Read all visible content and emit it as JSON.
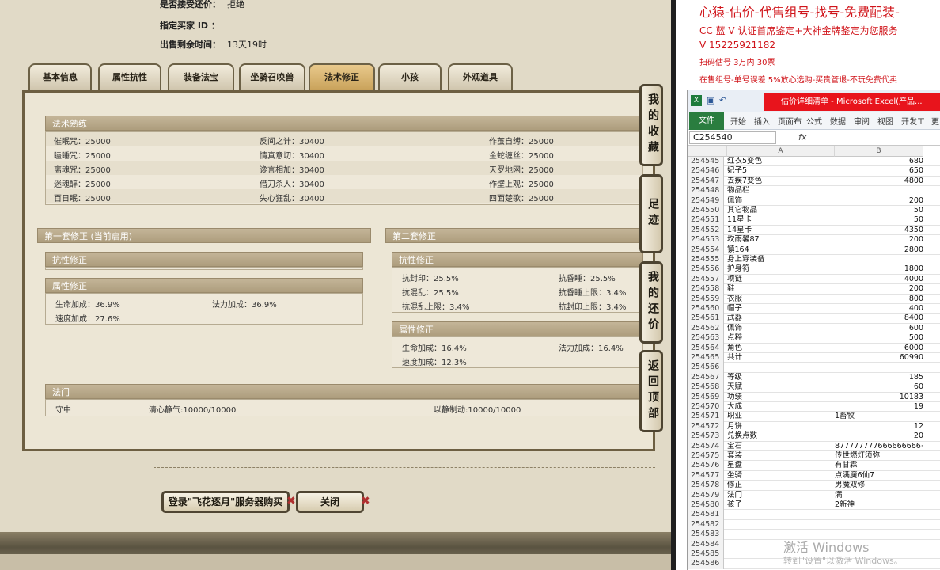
{
  "info": {
    "bargain_label": "是否接受还价：",
    "bargain_value": "拒绝",
    "buyer_label": "指定买家 ID ：",
    "remain_label": "出售剩余时间：",
    "remain_value": "13天19时"
  },
  "tabs": [
    "基本信息",
    "属性抗性",
    "装备法宝",
    "坐骑召唤兽",
    "法术修正",
    "小孩",
    "外观道具"
  ],
  "spell_mastery": {
    "title": "法术熟练",
    "col1": [
      "催眠咒：25000",
      "瞌睡咒：25000",
      "离魂咒：25000",
      "迷魂醉：25000",
      "百日眠：25000"
    ],
    "col2": [
      "反间之计：30400",
      "情真意切：30400",
      "谗言相加：30400",
      "借刀杀人：30400",
      "失心狂乱：30400"
    ],
    "col3": [
      "作茧自缚：25000",
      "金蛇缠丝：25000",
      "天罗地网：25000",
      "作壁上观：25000",
      "四面楚歌：25000"
    ]
  },
  "set1": {
    "title": "第一套修正 (当前启用)",
    "resist_title": "抗性修正",
    "attr_title": "属性修正",
    "attr": [
      "生命加成：36.9%",
      "法力加成：36.9%",
      "速度加成：27.6%"
    ]
  },
  "set2": {
    "title": "第二套修正",
    "resist_title": "抗性修正",
    "resist": [
      "抗封印：25.5%",
      "抗昏睡：25.5%",
      "抗混乱：25.5%",
      "抗昏睡上限：3.4%",
      "抗混乱上限：3.4%",
      "抗封印上限：3.4%"
    ],
    "attr_title": "属性修正",
    "attr": [
      "生命加成：16.4%",
      "法力加成：16.4%",
      "速度加成：12.3%"
    ]
  },
  "fameng": {
    "title": "法门",
    "items": [
      "守中",
      "清心静气:10000/10000",
      "以静制动:10000/10000"
    ]
  },
  "side_buttons": [
    "我的收藏",
    "足迹",
    "我的还价",
    "返回顶部"
  ],
  "buttons": {
    "login": "登录\"飞花逐月\"服务器购买",
    "close": "关闭"
  },
  "ad": {
    "title": "心猿-估价-代售组号-找号-免费配装-",
    "lines": [
      "CC 蓝 V 认证首席鉴定+大神金牌鉴定为您服务",
      "V 15225921182",
      "扫码估号 3万内 30票",
      "在售组号-单号误差 5%放心选购-买贵管退-不玩免费代卖"
    ]
  },
  "excel": {
    "title": "估价详细清单 - Microsoft Excel(产品...",
    "tabs": [
      "文件",
      "开始",
      "插入",
      "页面布",
      "公式",
      "数据",
      "审阅",
      "视图",
      "开发工",
      "更"
    ],
    "namebox": "C254540",
    "fx": "fx",
    "col_a": "A",
    "col_b": "B",
    "rows": [
      {
        "n": "254545",
        "a": "红衣5变色",
        "b": "680"
      },
      {
        "n": "254546",
        "a": "妃子5",
        "b": "650"
      },
      {
        "n": "254547",
        "a": "去疾7变色",
        "b": "4800"
      },
      {
        "n": "254548",
        "a": "物品栏",
        "b": ""
      },
      {
        "n": "254549",
        "a": "佩饰",
        "b": "200"
      },
      {
        "n": "254550",
        "a": "其它物品",
        "b": "50"
      },
      {
        "n": "254551",
        "a": "11星卡",
        "b": "50"
      },
      {
        "n": "254552",
        "a": "14星卡",
        "b": "4350"
      },
      {
        "n": "254553",
        "a": "坎雨馨87",
        "b": "200"
      },
      {
        "n": "254554",
        "a": "镇164",
        "b": "2800"
      },
      {
        "n": "254555",
        "a": "身上穿装备",
        "b": ""
      },
      {
        "n": "254556",
        "a": "护身符",
        "b": "1800"
      },
      {
        "n": "254557",
        "a": "项链",
        "b": "4000"
      },
      {
        "n": "254558",
        "a": "鞋",
        "b": "200"
      },
      {
        "n": "254559",
        "a": "衣服",
        "b": "800"
      },
      {
        "n": "254560",
        "a": "帽子",
        "b": "400"
      },
      {
        "n": "254561",
        "a": "武器",
        "b": "8400"
      },
      {
        "n": "254562",
        "a": "佩饰",
        "b": "600"
      },
      {
        "n": "254563",
        "a": "点粹",
        "b": "500"
      },
      {
        "n": "254564",
        "a": "角色",
        "b": "6000"
      },
      {
        "n": "254565",
        "a": "共计",
        "b": "60990"
      },
      {
        "n": "254566",
        "a": "",
        "b": ""
      },
      {
        "n": "254567",
        "a": "等级",
        "b": "185"
      },
      {
        "n": "254568",
        "a": "天赋",
        "b": "60"
      },
      {
        "n": "254569",
        "a": "功绩",
        "b": "10183"
      },
      {
        "n": "254570",
        "a": "大成",
        "b": "19"
      },
      {
        "n": "254571",
        "a": "职业",
        "b": "1畜牧",
        "t": true
      },
      {
        "n": "254572",
        "a": "月饼",
        "b": "12"
      },
      {
        "n": "254573",
        "a": "兑换点数",
        "b": "20"
      },
      {
        "n": "254574",
        "a": "宝石",
        "b": "877777777666666666+",
        "t": true
      },
      {
        "n": "254575",
        "a": "套装",
        "b": "传世燃灯须弥",
        "t": true
      },
      {
        "n": "254576",
        "a": "星盘",
        "b": "有甘霖",
        "t": true
      },
      {
        "n": "254577",
        "a": "坐骑",
        "b": "点满魔6仙7",
        "t": true
      },
      {
        "n": "254578",
        "a": "修正",
        "b": "男魔双修",
        "t": true
      },
      {
        "n": "254579",
        "a": "法门",
        "b": "满",
        "t": true
      },
      {
        "n": "254580",
        "a": "孩子",
        "b": "2新神",
        "t": true
      },
      {
        "n": "254581",
        "a": "",
        "b": ""
      },
      {
        "n": "254582",
        "a": "",
        "b": ""
      },
      {
        "n": "254583",
        "a": "",
        "b": ""
      },
      {
        "n": "254584",
        "a": "",
        "b": ""
      },
      {
        "n": "254585",
        "a": "",
        "b": ""
      },
      {
        "n": "254586",
        "a": "",
        "b": ""
      }
    ]
  },
  "watermark": {
    "line1": "激活 Windows",
    "line2": "转到\"设置\"以激活 Windows。"
  }
}
